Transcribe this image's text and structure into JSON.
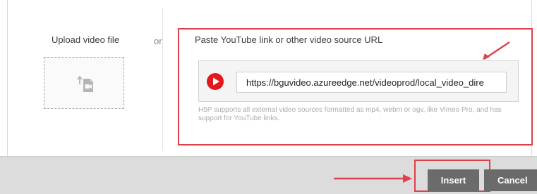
{
  "upload": {
    "title": "Upload video file",
    "icon": "upload-video-icon"
  },
  "separator": {
    "or_label": "or"
  },
  "url_source": {
    "title": "Paste YouTube link or other video source URL",
    "icon": "youtube-play-icon",
    "input_value": "https://bguvideo.azureedge.net/videoprod/local_video_dire",
    "help_text": "H5P supports all external video sources formatted as mp4, webm or ogv, like Vimeo Pro, and has support for YouTube links."
  },
  "footer": {
    "insert_label": "Insert",
    "cancel_label": "Cancel"
  },
  "colors": {
    "annotation_red": "#e0404a",
    "youtube_red": "#e3181f",
    "button_gray": "#6b6b6b",
    "footer_bg": "#dcdcdc"
  }
}
